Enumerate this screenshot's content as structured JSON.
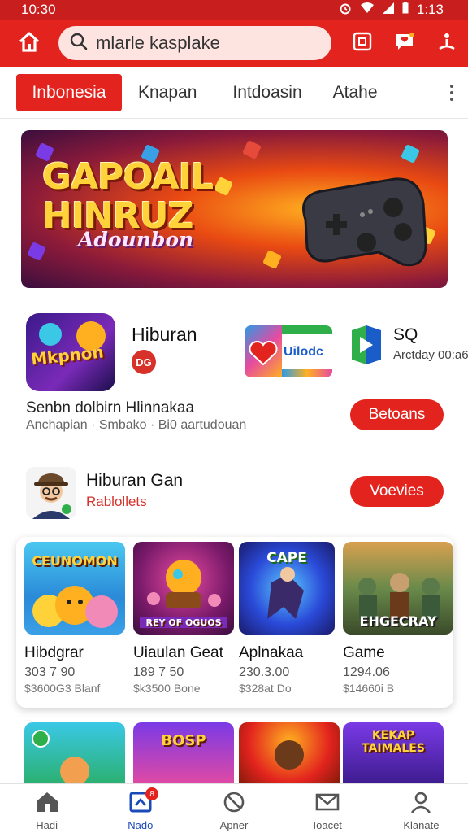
{
  "status_bar": {
    "time": "10:30",
    "battery": "1:13"
  },
  "search": {
    "query": "mlarle kasplake"
  },
  "tabs": [
    {
      "label": "Inbonesia"
    },
    {
      "label": "Knapan"
    },
    {
      "label": "Intdoasin"
    },
    {
      "label": "Atahe"
    }
  ],
  "banner": {
    "title_line1": "GAPOAIL",
    "title_line2": "HINRUZ",
    "subtitle": "Adounbon"
  },
  "apps": {
    "featured_icon_text": "Mkpnon",
    "featured_title": "Hiburan",
    "featured_badge": "DG",
    "second_icon_text": "Uilodc",
    "third_title": "SQ",
    "third_sub": "Arctday 00:a6",
    "line1": "Senbn dolbirn Hlinnakaa",
    "line2": "Anchapian · Smbako · Bi0 aartudouan",
    "button": "Betoans"
  },
  "section2": {
    "title": "Hiburan Gan",
    "subtitle": "Rablollets",
    "button": "Voevies"
  },
  "games": [
    {
      "name": "Hibdgrar",
      "value": "303 7 90",
      "sub": "$3600G3 Blanf",
      "thumb_text": "CEUNOMON"
    },
    {
      "name": "Uiaulan Geat",
      "value": "189 7 50",
      "sub": "$k3500 Bone",
      "thumb_text": "REY OF OGUOS"
    },
    {
      "name": "Aplnakaa",
      "value": "230.3.00",
      "sub": "$328at Do",
      "thumb_text": "CAPE"
    },
    {
      "name": "Game",
      "value": "1294.06",
      "sub": "$14660i B",
      "thumb_text": "EHGECRAY"
    }
  ],
  "bottom_thumbs": [
    {
      "text": ""
    },
    {
      "text": "BOSP"
    },
    {
      "text": ""
    },
    {
      "text": "KEKAP TAIMALES"
    }
  ],
  "bottom_nav": [
    {
      "label": "Hadi",
      "icon": "home-icon"
    },
    {
      "label": "Nado",
      "icon": "apps-icon",
      "badge": "8"
    },
    {
      "label": "Apner",
      "icon": "block-icon"
    },
    {
      "label": "Ioacet",
      "icon": "mail-icon"
    },
    {
      "label": "Klanate",
      "icon": "profile-icon"
    }
  ],
  "colors": {
    "brand_red": "#e2231e",
    "dark_red": "#c81e1e",
    "nav_active": "#1a4ab8"
  }
}
